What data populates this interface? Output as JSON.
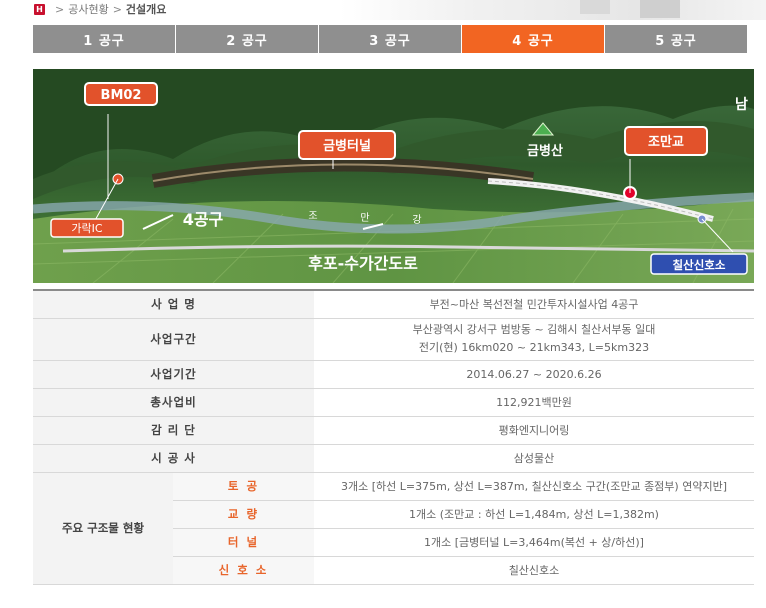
{
  "breadcrumb": {
    "items": [
      "공사현황",
      "건설개요"
    ]
  },
  "tabs": [
    {
      "label": "1 공구",
      "active": false
    },
    {
      "label": "2 공구",
      "active": false
    },
    {
      "label": "3 공구",
      "active": false
    },
    {
      "label": "4 공구",
      "active": true
    },
    {
      "label": "5 공구",
      "active": false
    }
  ],
  "map": {
    "labels": {
      "bm": "BM02",
      "tunnel": "금병터널",
      "mountain": "금병산",
      "bridge": "조만교",
      "ic": "가락IC",
      "section": "4공구",
      "river": [
        "조",
        "만",
        "강"
      ],
      "road": "후포-수가간도로",
      "signal": "칠산신호소",
      "corner": "남"
    }
  },
  "info": {
    "rows": [
      {
        "label": "사 업 명",
        "value": "부전~마산 복선전철 민간투자시설사업 4공구"
      },
      {
        "label": "사업구간",
        "value_lines": [
          "부산광역시 강서구 범방동 ~ 김해시 칠산서부동 일대",
          "전기(현) 16km020 ~ 21km343, L=5km323"
        ]
      },
      {
        "label": "사업기간",
        "value": "2014.06.27 ~ 2020.6.26"
      },
      {
        "label": "총사업비",
        "value": "112,921백만원"
      },
      {
        "label": "감 리 단",
        "value": "평화엔지니어링"
      },
      {
        "label": "시 공 사",
        "value": "삼성물산"
      }
    ],
    "structures": {
      "group_label": "주요 구조물 현황",
      "items": [
        {
          "label": "토 공",
          "value": "3개소 [하선 L=375m, 상선 L=387m, 칠산신호소 구간(조만교 종점부) 연약지반]"
        },
        {
          "label": "교 량",
          "value": "1개소 (조만교 : 하선 L=1,484m, 상선 L=1,382m)"
        },
        {
          "label": "터 널",
          "value": "1개소 [금병터널 L=3,464m(복선 + 상/하선)]"
        },
        {
          "label": "신 호 소",
          "value": "칠산신호소"
        }
      ]
    }
  },
  "colors": {
    "accent": "#f26522",
    "tab_inactive": "#8f8f8f",
    "callout": "#e2522b",
    "home": "#c8102e"
  }
}
